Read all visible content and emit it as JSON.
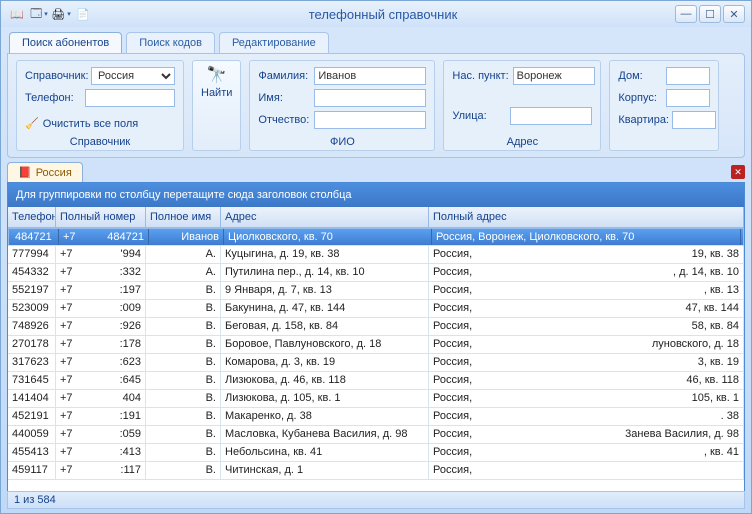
{
  "window": {
    "title": "телефонный справочник"
  },
  "tabs": {
    "search_sub": "Поиск абонентов",
    "search_codes": "Поиск кодов",
    "edit": "Редактирование"
  },
  "form": {
    "dir_label": "Справочник:",
    "dir_value": "Россия",
    "phone_label": "Телефон:",
    "phone_value": "",
    "clear": "Очистить все поля",
    "dir_caption": "Справочник",
    "find": "Найти",
    "surname_label": "Фамилия:",
    "surname_value": "Иванов",
    "name_label": "Имя:",
    "name_value": "",
    "patronymic_label": "Отчество:",
    "patronymic_value": "",
    "fio_caption": "ФИО",
    "place_label": "Нас. пункт:",
    "place_value": "Воронеж",
    "street_label": "Улица:",
    "street_value": "",
    "addr_caption": "Адрес",
    "house_label": "Дом:",
    "house_value": "",
    "korpus_label": "Корпус:",
    "korpus_value": "",
    "flat_label": "Квартира:",
    "flat_value": ""
  },
  "country_tab": "Россия",
  "group_hint": "Для группировки по столбцу перетащите сюда заголовок столбца",
  "columns": {
    "phone": "Телефон",
    "full_number": "Полный номер",
    "full_name": "Полное имя",
    "address": "Адрес",
    "full_address": "Полный адрес"
  },
  "rows": [
    {
      "phone": "484721",
      "num": "+7",
      "num2": "484721",
      "name": "Иванов",
      "addr": "Циолковского, кв. 70",
      "faddr": "Россия, Воронеж, Циолковского, кв. 70",
      "sel": true
    },
    {
      "phone": "777994",
      "num": "+7",
      "num2": "'994",
      "name": "А.",
      "addr": "Куцыгина, д. 19, кв. 38",
      "faddr": "Россия,",
      "faddr2": "19, кв. 38"
    },
    {
      "phone": "454332",
      "num": "+7",
      "num2": ":332",
      "name": "А.",
      "addr": "Путилина пер., д. 14, кв. 10",
      "faddr": "Россия,",
      "faddr2": ", д. 14, кв. 10"
    },
    {
      "phone": "552197",
      "num": "+7",
      "num2": ":197",
      "name": "В.",
      "addr": "9 Января, д. 7, кв. 13",
      "faddr": "Россия,",
      "faddr2": ", кв. 13"
    },
    {
      "phone": "523009",
      "num": "+7",
      "num2": ":009",
      "name": "В.",
      "addr": "Бакунина, д. 47, кв. 144",
      "faddr": "Россия,",
      "faddr2": "47, кв. 144"
    },
    {
      "phone": "748926",
      "num": "+7",
      "num2": ":926",
      "name": "В.",
      "addr": "Беговая, д. 158, кв. 84",
      "faddr": "Россия,",
      "faddr2": "58, кв. 84"
    },
    {
      "phone": "270178",
      "num": "+7",
      "num2": ":178",
      "name": "В.",
      "addr": "Боровое, Павлуновского, д. 18",
      "faddr": "Россия,",
      "faddr2": "луновского, д. 18"
    },
    {
      "phone": "317623",
      "num": "+7",
      "num2": ":623",
      "name": "В.",
      "addr": "Комарова, д. 3, кв. 19",
      "faddr": "Россия,",
      "faddr2": "3, кв. 19"
    },
    {
      "phone": "731645",
      "num": "+7",
      "num2": ":645",
      "name": "В.",
      "addr": "Лизюкова, д. 46, кв. 118",
      "faddr": "Россия,",
      "faddr2": "46, кв. 118"
    },
    {
      "phone": "141404",
      "num": "+7",
      "num2": "404",
      "name": "В.",
      "addr": "Лизюкова, д. 105, кв. 1",
      "faddr": "Россия,",
      "faddr2": "105, кв. 1"
    },
    {
      "phone": "452191",
      "num": "+7",
      "num2": ":191",
      "name": "В.",
      "addr": "Макаренко, д. 38",
      "faddr": "Россия,",
      "faddr2": ". 38"
    },
    {
      "phone": "440059",
      "num": "+7",
      "num2": ":059",
      "name": "В.",
      "addr": "Масловка, Кубанева Василия, д. 98",
      "faddr": "Россия,",
      "faddr2": "3анева Василия, д. 98"
    },
    {
      "phone": "455413",
      "num": "+7",
      "num2": ":413",
      "name": "В.",
      "addr": "Небольсина, кв. 41",
      "faddr": "Россия,",
      "faddr2": ", кв. 41"
    },
    {
      "phone": "459117",
      "num": "+7",
      "num2": ":117",
      "name": "В.",
      "addr": "Читинская, д. 1",
      "faddr": "Россия,",
      "faddr2": ""
    }
  ],
  "status": "1 из 584"
}
